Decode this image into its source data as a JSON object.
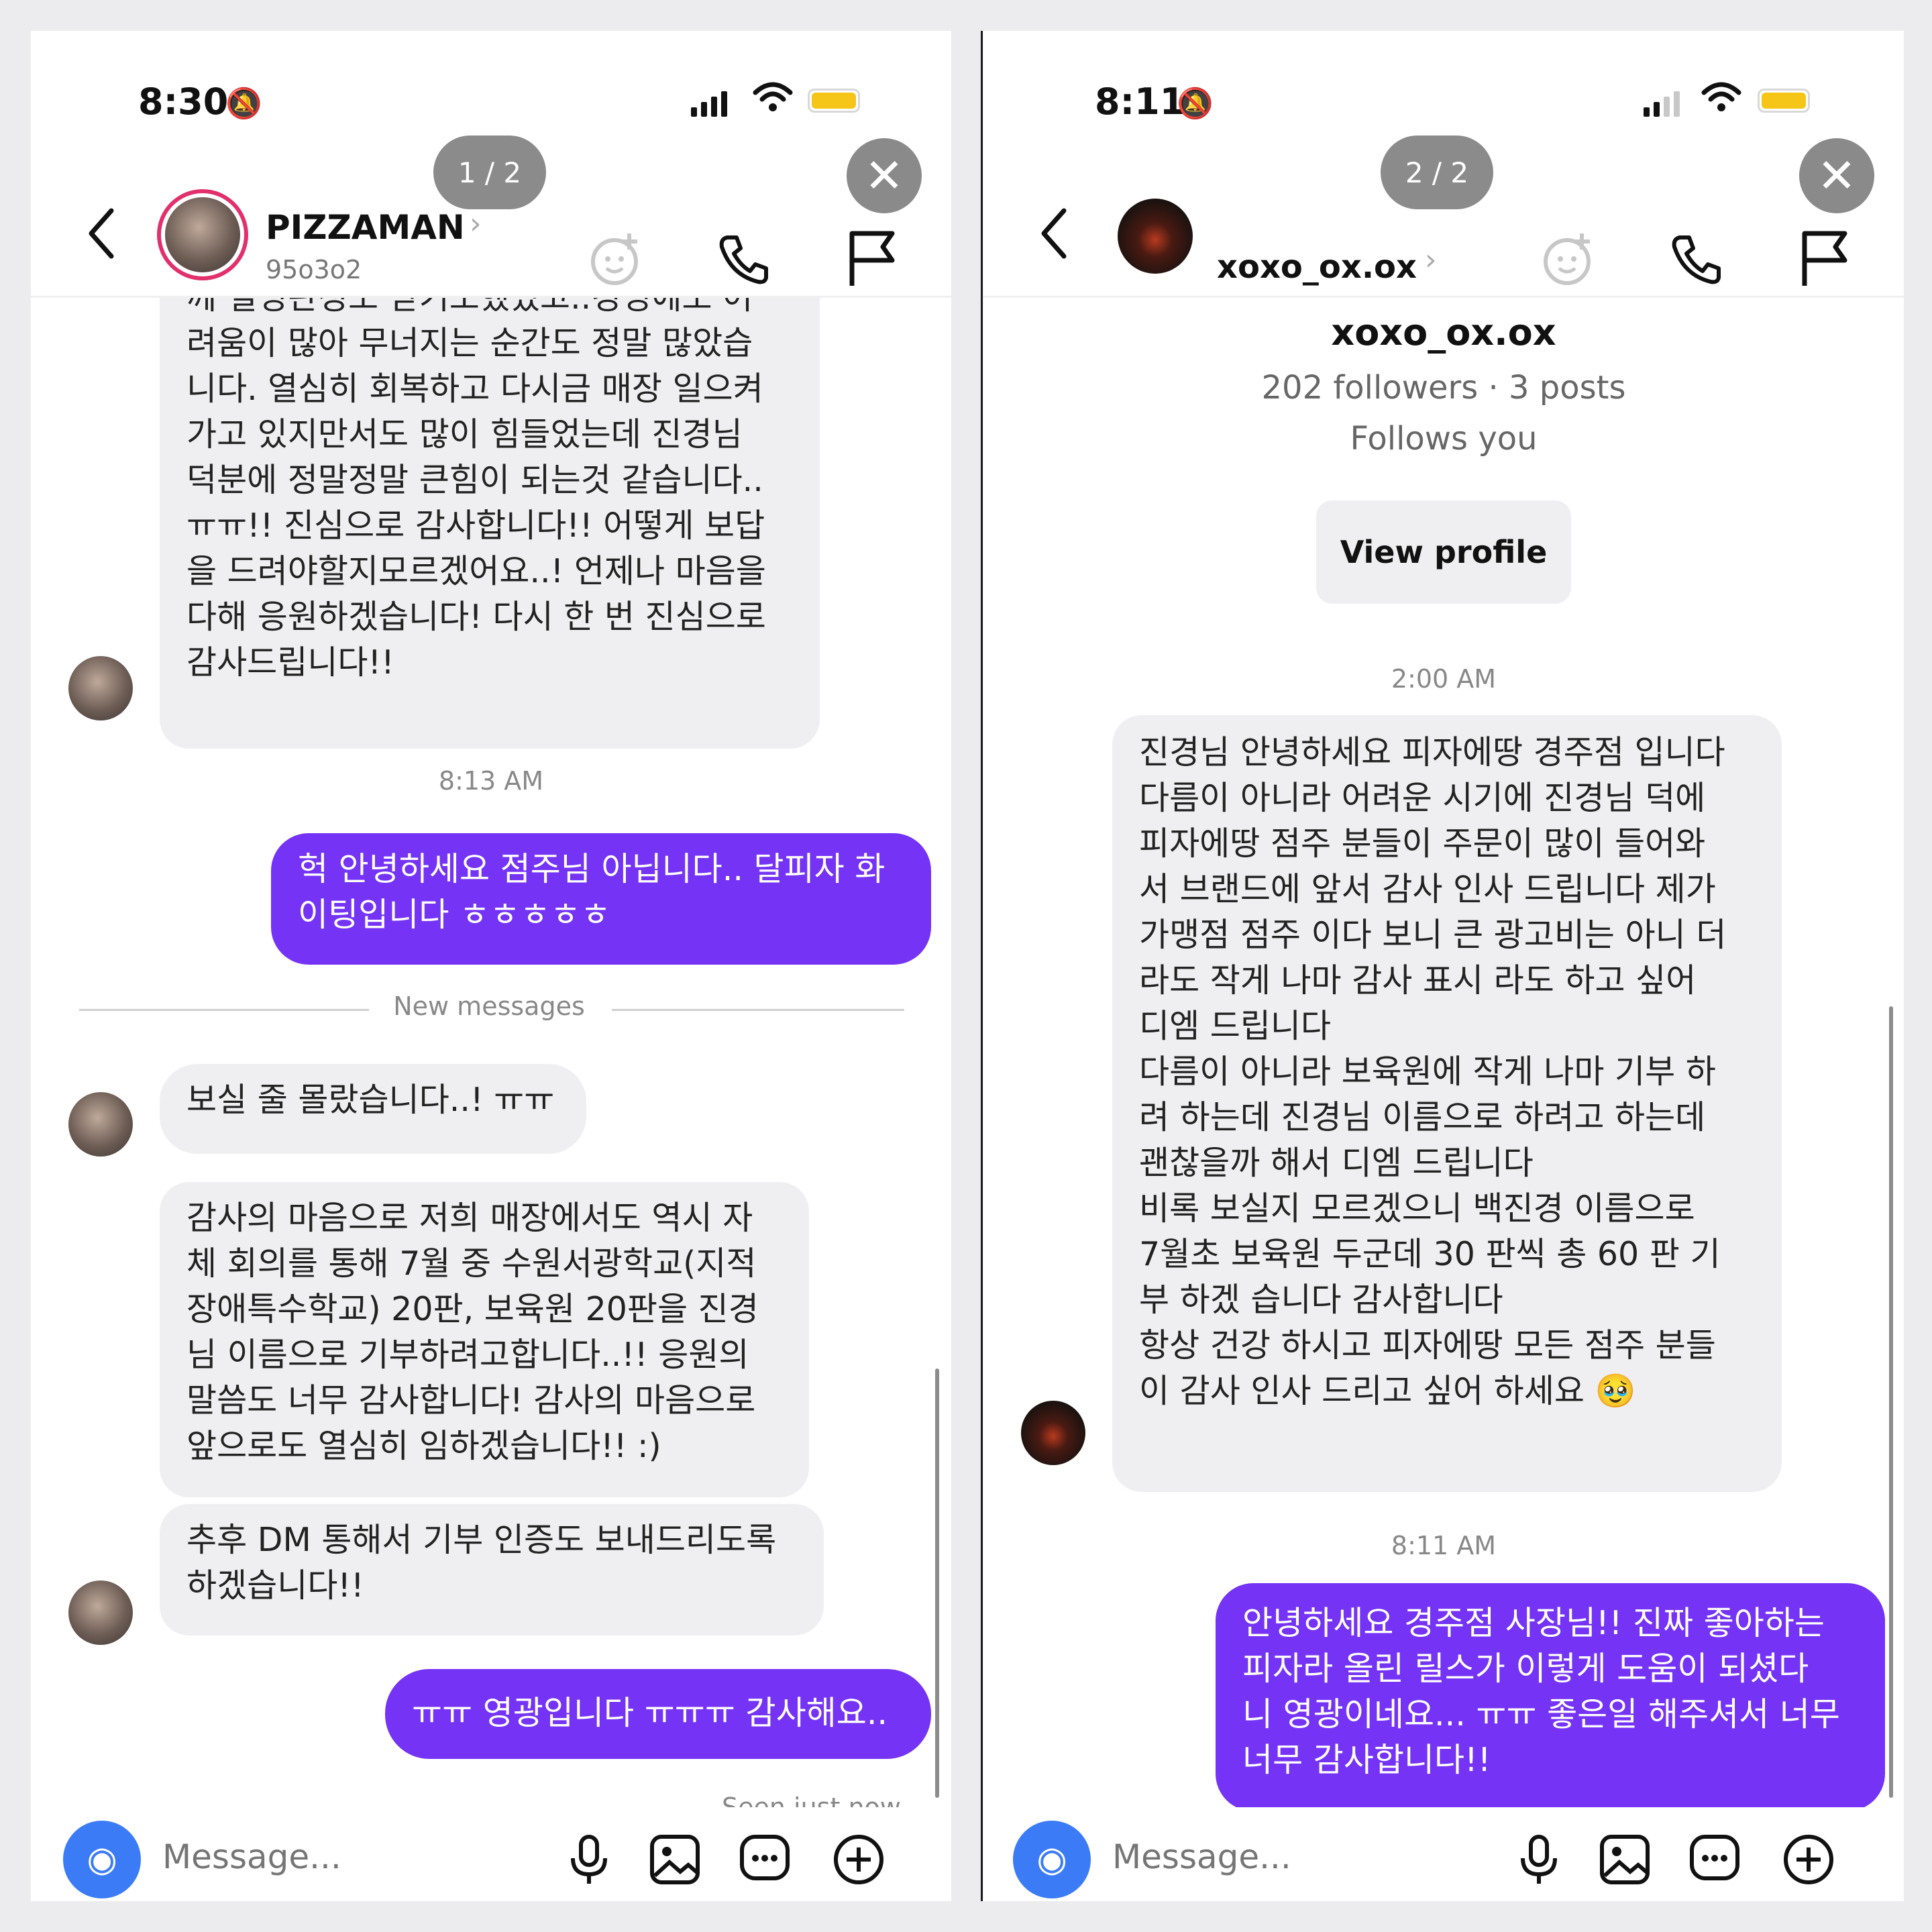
{
  "left": {
    "status": {
      "time": "8:30"
    },
    "pager": "1 / 2",
    "header": {
      "name": "PIZZAMAN",
      "sub": "95o3o2"
    },
    "messages": {
      "cut_line": "께 실명판정도 받기도했었고..경영에도 어",
      "msg1": [
        "려움이 많아 무너지는 순간도 정말 많았습",
        "니다. 열심히 회복하고 다시금 매장 일으켜",
        "가고 있지만서도 많이 힘들었는데 진경님",
        "덕분에 정말정말 큰힘이 되는것 같습니다..",
        "ㅠㅠ!! 진심으로 감사합니다!! 어떻게 보답",
        "을 드려야할지모르겠어요..! 언제나 마음을",
        "다해 응원하겠습니다! 다시 한 번 진심으로",
        "감사드립니다!!"
      ],
      "stamp1": "8:13 AM",
      "out1": [
        "헉 안녕하세요 점주님 아닙니다.. 달피자 화",
        "이팅입니다 ㅎㅎㅎㅎㅎ"
      ],
      "new_messages": "New messages",
      "msg2": "보실 줄 몰랐습니다..! ㅠㅠ",
      "msg3": [
        "감사의 마음으로 저희 매장에서도 역시 자",
        "체 회의를 통해 7월 중 수원서광학교(지적",
        "장애특수학교) 20판, 보육원 20판을 진경",
        "님 이름으로 기부하려고합니다..!! 응원의",
        "말씀도 너무 감사합니다! 감사의 마음으로",
        "앞으로도 열심히 임하겠습니다!!  :)"
      ],
      "msg4": [
        "추후 DM 통해서 기부 인증도 보내드리도록",
        "하겠습니다!!"
      ],
      "out2": "ㅠㅠ 영광입니다 ㅠㅠㅠ 감사해요..",
      "seen": "Seen just now"
    },
    "compose": {
      "placeholder": "Message..."
    }
  },
  "right": {
    "status": {
      "time": "8:11"
    },
    "pager": "2 / 2",
    "header": {
      "name": "xoxo_ox.ox"
    },
    "profile": {
      "name": "xoxo_ox.ox",
      "stats": "202 followers · 3 posts",
      "follows": "Follows you",
      "view_button": "View profile"
    },
    "messages": {
      "stamp1": "2:00 AM",
      "msg1": [
        "진경님 안녕하세요 피자에땅 경주점 입니다",
        "다름이 아니라  어려운 시기에 진경님 덕에",
        "피자에땅 점주 분들이 주문이 많이 들어와",
        "서 브랜드에 앞서 감사 인사 드립니다 제가",
        "가맹점 점주 이다 보니 큰 광고비는 아니 더",
        "라도 작게 나마  감사 표시 라도 하고 싶어",
        "디엠 드립니다",
        "다름이 아니라 보육원에 작게 나마 기부 하",
        "려 하는데 진경님 이름으로 하려고 하는데",
        "괜찮을까 해서 디엠 드립니다",
        "비록 보실지 모르겠으니 백진경 이름으로",
        " 7월초 보육원 두군데 30 판씩  총 60 판 기",
        "부 하겠 습니다 감사합니다",
        "항상 건강 하시고 피자에땅 모든 점주 분들",
        "이 감사 인사 드리고 싶어 하세요 🥹"
      ],
      "stamp2": "8:11 AM",
      "out1": [
        "안녕하세요 경주점 사장님!! 진짜 좋아하는",
        "피자라 올린 릴스가 이렇게 도움이 되셨다",
        "니 영광이네요... ㅠㅠ 좋은일 해주셔서 너무",
        "너무 감사합니다!!"
      ]
    },
    "compose": {
      "placeholder": "Message..."
    }
  },
  "colors": {
    "outgoing": "#7433f5",
    "incoming": "#efeff1",
    "camera": "#3b7cf6",
    "battery": "#f5c518",
    "story_ring": "#e1306c"
  },
  "icons": [
    "bell-off-icon",
    "signal-icon",
    "wifi-icon",
    "battery-icon",
    "close-icon",
    "back-chevron-icon",
    "chevron-right-icon",
    "sticker-icon",
    "phone-icon",
    "flag-icon",
    "camera-icon",
    "microphone-icon",
    "image-icon",
    "sticker-chat-icon",
    "plus-circle-icon"
  ]
}
